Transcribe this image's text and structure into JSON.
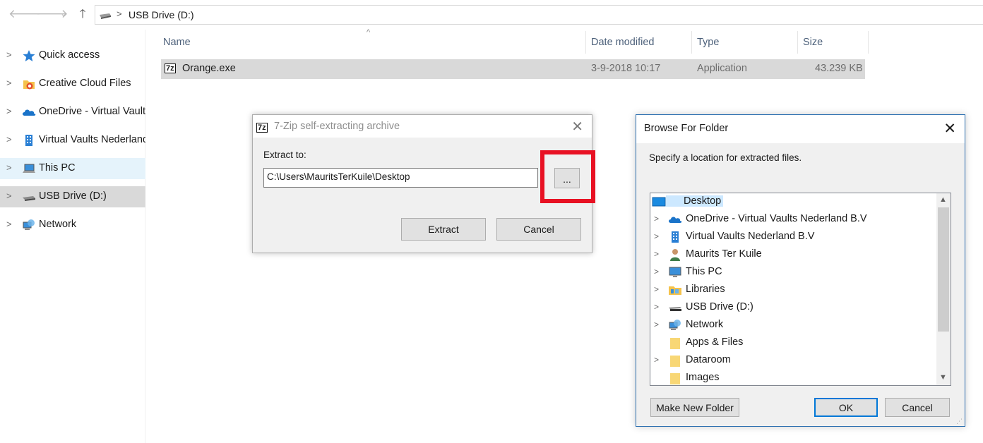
{
  "address_bar": {
    "back_icon": "arrow-left-icon",
    "forward_icon": "arrow-right-icon",
    "recent_icon": "chevron-down-icon",
    "up_icon": "arrow-up-icon",
    "separator": ">",
    "path": "USB Drive (D:)"
  },
  "sidebar": {
    "items": [
      {
        "label": "Quick access",
        "icon": "star-icon"
      },
      {
        "label": "Creative Cloud Files",
        "icon": "creative-cloud-icon"
      },
      {
        "label": "OneDrive - Virtual Vaults Nederland B.V",
        "icon": "onedrive-cloud-icon"
      },
      {
        "label": "Virtual Vaults Nederland B.V",
        "icon": "building-icon"
      },
      {
        "label": "This PC",
        "icon": "computer-icon"
      },
      {
        "label": "USB Drive (D:)",
        "icon": "usb-drive-icon"
      },
      {
        "label": "Network",
        "icon": "network-icon"
      }
    ]
  },
  "file_list": {
    "columns": {
      "name": "Name",
      "date": "Date modified",
      "type": "Type",
      "size": "Size"
    },
    "sort_indicator": "^",
    "rows": [
      {
        "icon_text": "7z",
        "name": "Orange.exe",
        "date": "3-9-2018 10:17",
        "type": "Application",
        "size": "43.239 KB"
      }
    ]
  },
  "zip_dialog": {
    "icon_text": "7z",
    "title": "7-Zip self-extracting archive",
    "close": "✕",
    "extract_label": "Extract to:",
    "path_value": "C:\\Users\\MauritsTerKuile\\Desktop",
    "browse_label": "...",
    "extract_button": "Extract",
    "cancel_button": "Cancel",
    "highlight_color": "#e81123"
  },
  "browse_dialog": {
    "title": "Browse For Folder",
    "close": "✕",
    "hint": "Specify a location for extracted files.",
    "tree": [
      {
        "label": "Desktop",
        "icon": "desktop-icon",
        "expandable": false,
        "selected": true
      },
      {
        "label": "OneDrive - Virtual Vaults Nederland B.V",
        "icon": "onedrive-cloud-icon",
        "expandable": true
      },
      {
        "label": "Virtual Vaults Nederland B.V",
        "icon": "building-icon",
        "expandable": true
      },
      {
        "label": "Maurits Ter Kuile",
        "icon": "user-icon",
        "expandable": true
      },
      {
        "label": "This PC",
        "icon": "computer-icon",
        "expandable": true
      },
      {
        "label": "Libraries",
        "icon": "libraries-icon",
        "expandable": true
      },
      {
        "label": "USB Drive (D:)",
        "icon": "usb-drive-icon",
        "expandable": true
      },
      {
        "label": "Network",
        "icon": "network-icon",
        "expandable": true
      },
      {
        "label": "Apps & Files",
        "icon": "folder-icon",
        "expandable": false
      },
      {
        "label": "Dataroom",
        "icon": "folder-icon",
        "expandable": true
      },
      {
        "label": "Images",
        "icon": "folder-icon",
        "expandable": false
      }
    ],
    "make_new_folder": "Make New Folder",
    "ok": "OK",
    "cancel": "Cancel"
  }
}
